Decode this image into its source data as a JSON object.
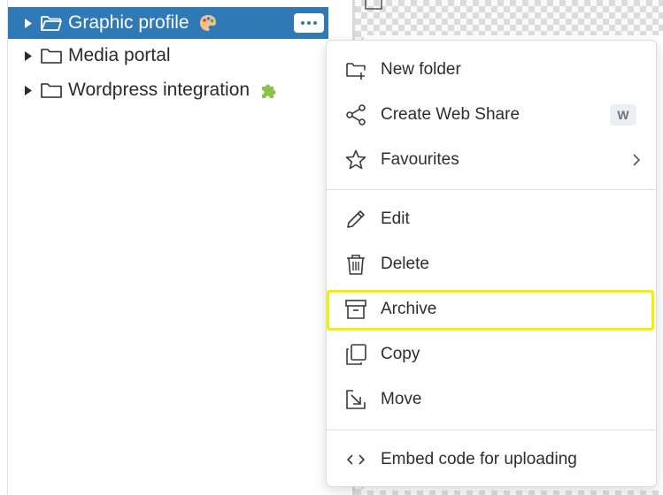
{
  "tree": {
    "items": [
      {
        "label": "Graphic profile",
        "icon": "folder-open-icon",
        "badge_icon": "artist-palette-icon",
        "selected": true
      },
      {
        "label": "Media portal",
        "icon": "folder-icon",
        "selected": false
      },
      {
        "label": "Wordpress integration",
        "icon": "folder-icon",
        "badge_icon": "puzzle-piece-icon",
        "selected": false
      }
    ],
    "more_button_icon": "more-horizontal-icon"
  },
  "context_menu": {
    "items": [
      {
        "label": "New folder",
        "icon": "new-folder-icon"
      },
      {
        "label": "Create Web Share",
        "icon": "share-icon",
        "shortcut": "W"
      },
      {
        "label": "Favourites",
        "icon": "star-icon",
        "has_submenu": true
      },
      {
        "label": "Edit",
        "icon": "pencil-icon"
      },
      {
        "label": "Delete",
        "icon": "trash-icon"
      },
      {
        "label": "Archive",
        "icon": "archive-box-icon",
        "highlighted": true
      },
      {
        "label": "Copy",
        "icon": "copy-icon"
      },
      {
        "label": "Move",
        "icon": "move-icon"
      },
      {
        "label": "Embed code for uploading",
        "icon": "code-icon"
      }
    ]
  },
  "colors": {
    "selection": "#2f79b6",
    "highlight_outline": "#f2f200",
    "shortcut_bg": "#eceef2"
  }
}
